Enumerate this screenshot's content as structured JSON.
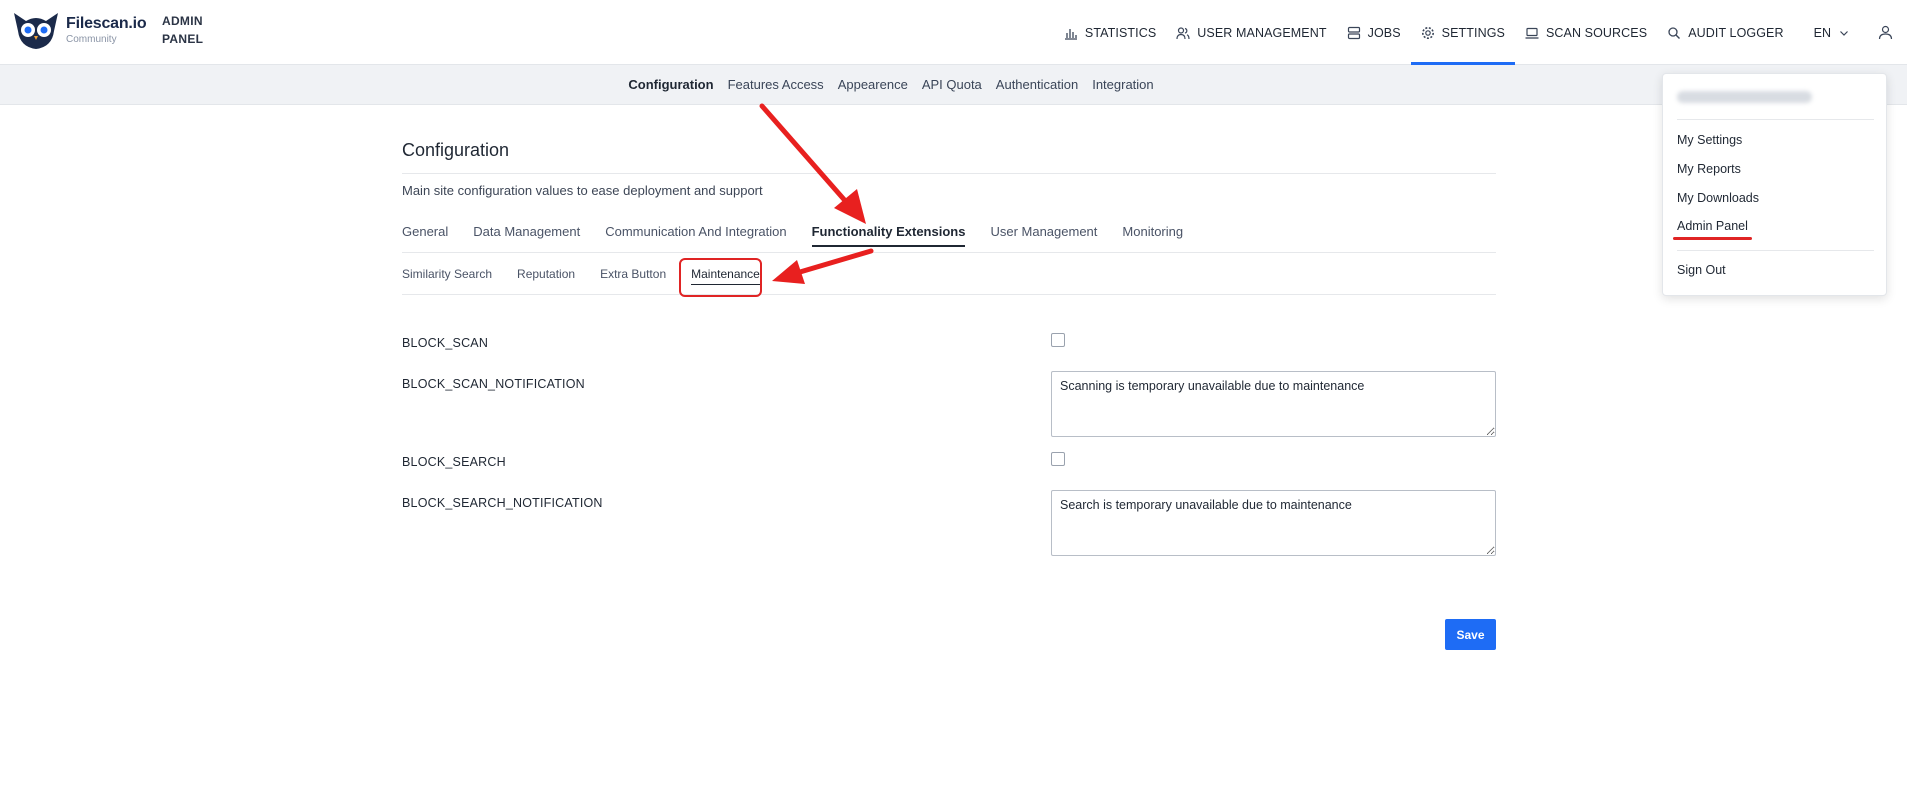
{
  "header": {
    "brand_name": "Filescan.io",
    "brand_sub": "Community",
    "admin_line1": "ADMIN",
    "admin_line2": "PANEL",
    "nav": [
      {
        "label": "STATISTICS",
        "icon": "bar-chart-icon"
      },
      {
        "label": "USER MANAGEMENT",
        "icon": "users-icon"
      },
      {
        "label": "JOBS",
        "icon": "server-icon"
      },
      {
        "label": "SETTINGS",
        "icon": "gear-icon",
        "active": true
      },
      {
        "label": "SCAN SOURCES",
        "icon": "laptop-icon"
      },
      {
        "label": "AUDIT LOGGER",
        "icon": "search-icon"
      }
    ],
    "lang": "EN",
    "accent": "#1e6cf5"
  },
  "subnav": {
    "items": [
      "Configuration",
      "Features Access",
      "Appearence",
      "API Quota",
      "Authentication",
      "Integration"
    ],
    "active": "Configuration"
  },
  "page": {
    "title": "Configuration",
    "description": "Main site configuration values to ease deployment and support",
    "tabs": [
      "General",
      "Data Management",
      "Communication And Integration",
      "Functionality Extensions",
      "User Management",
      "Monitoring"
    ],
    "active_tab": "Functionality Extensions",
    "subtabs": [
      "Similarity Search",
      "Reputation",
      "Extra Button",
      "Maintenance"
    ],
    "active_subtab": "Maintenance",
    "fields": [
      {
        "label": "BLOCK_SCAN",
        "type": "checkbox",
        "checked": false
      },
      {
        "label": "BLOCK_SCAN_NOTIFICATION",
        "type": "textarea",
        "value": "Scanning is temporary unavailable due to maintenance"
      },
      {
        "label": "BLOCK_SEARCH",
        "type": "checkbox",
        "checked": false
      },
      {
        "label": "BLOCK_SEARCH_NOTIFICATION",
        "type": "textarea",
        "value": "Search is temporary unavailable due to maintenance"
      }
    ],
    "save_label": "Save"
  },
  "user_menu": {
    "items": [
      "My Settings",
      "My Reports",
      "My Downloads",
      "Admin Panel"
    ],
    "sign_out": "Sign Out",
    "highlight_color": "#e02424"
  }
}
